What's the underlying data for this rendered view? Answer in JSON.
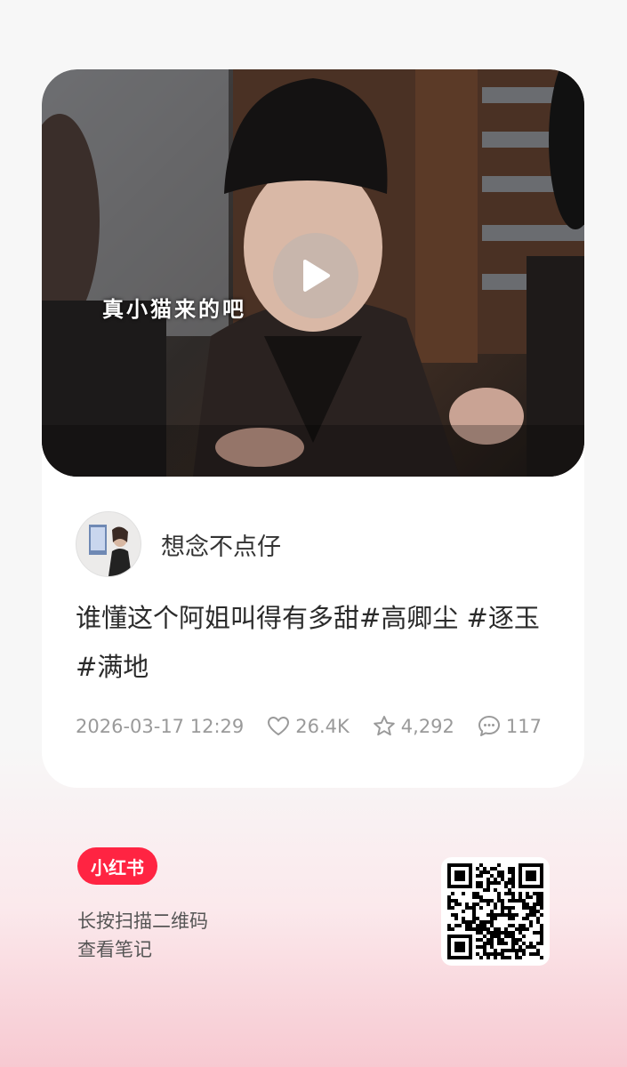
{
  "video": {
    "caption": "真小猫来的吧"
  },
  "author": {
    "name": "想念不点仔"
  },
  "post": {
    "title": "谁懂这个阿姐叫得有多甜#高卿尘 #逐玉 #满地",
    "date": "2026-03-17 12:29",
    "likes": "26.4K",
    "collects": "4,292",
    "comments": "117"
  },
  "footer": {
    "logo_text": "小红书",
    "hint_line1": "长按扫描二维码",
    "hint_line2": "查看笔记"
  },
  "icons": {
    "play": "play-icon",
    "like": "heart-icon",
    "collect": "star-icon",
    "comment": "comment-bubble-icon",
    "qr": "qr-code-icon"
  },
  "colors": {
    "brand": "#ff2442",
    "meta_text": "#9a9a9a"
  }
}
